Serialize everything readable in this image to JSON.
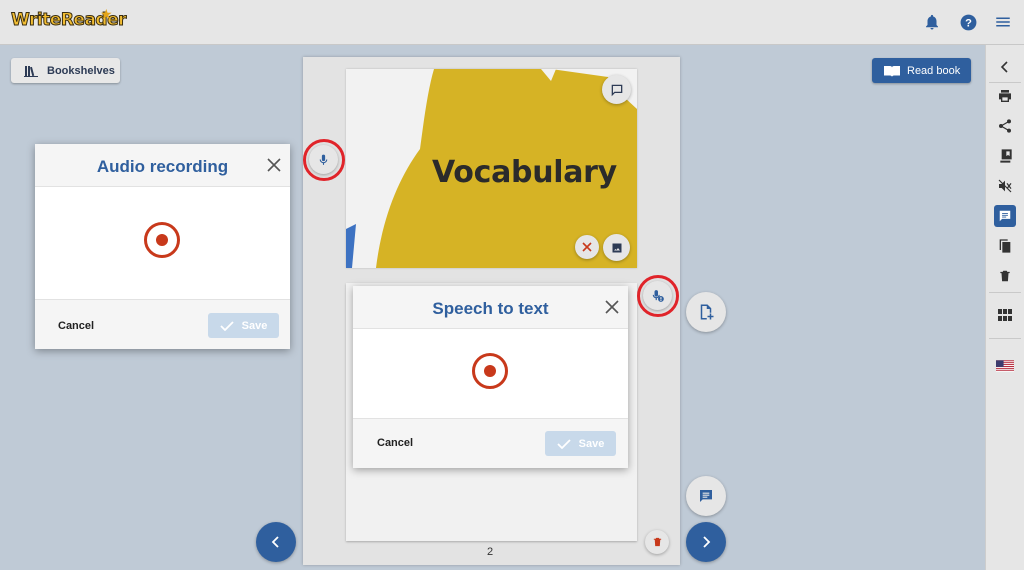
{
  "app": {
    "logo_text": "WriteReader"
  },
  "header": {
    "icons": [
      "bell-icon",
      "help-icon",
      "menu-icon"
    ]
  },
  "toolbar": {
    "bookshelves_label": "Bookshelves",
    "read_book_label": "Read book"
  },
  "book": {
    "cover_title": "Vocabulary",
    "page_number": "2"
  },
  "audio_dialog": {
    "title": "Audio recording",
    "cancel_label": "Cancel",
    "save_label": "Save"
  },
  "speech_dialog": {
    "title": "Speech to text",
    "cancel_label": "Cancel",
    "save_label": "Save"
  },
  "right_toolbar": {
    "items": [
      "collapse-icon",
      "print-icon",
      "share-icon",
      "library-icon",
      "mute-icon",
      "comment-icon",
      "copy-icon",
      "delete-icon",
      "grid-icon",
      "language-flag-icon"
    ],
    "active_item": "comment-icon"
  },
  "colors": {
    "brand_blue": "#2f5f9e",
    "record_red": "#c8391b",
    "highlight_red": "#e0242a",
    "cover_yellow": "#d6b325"
  }
}
